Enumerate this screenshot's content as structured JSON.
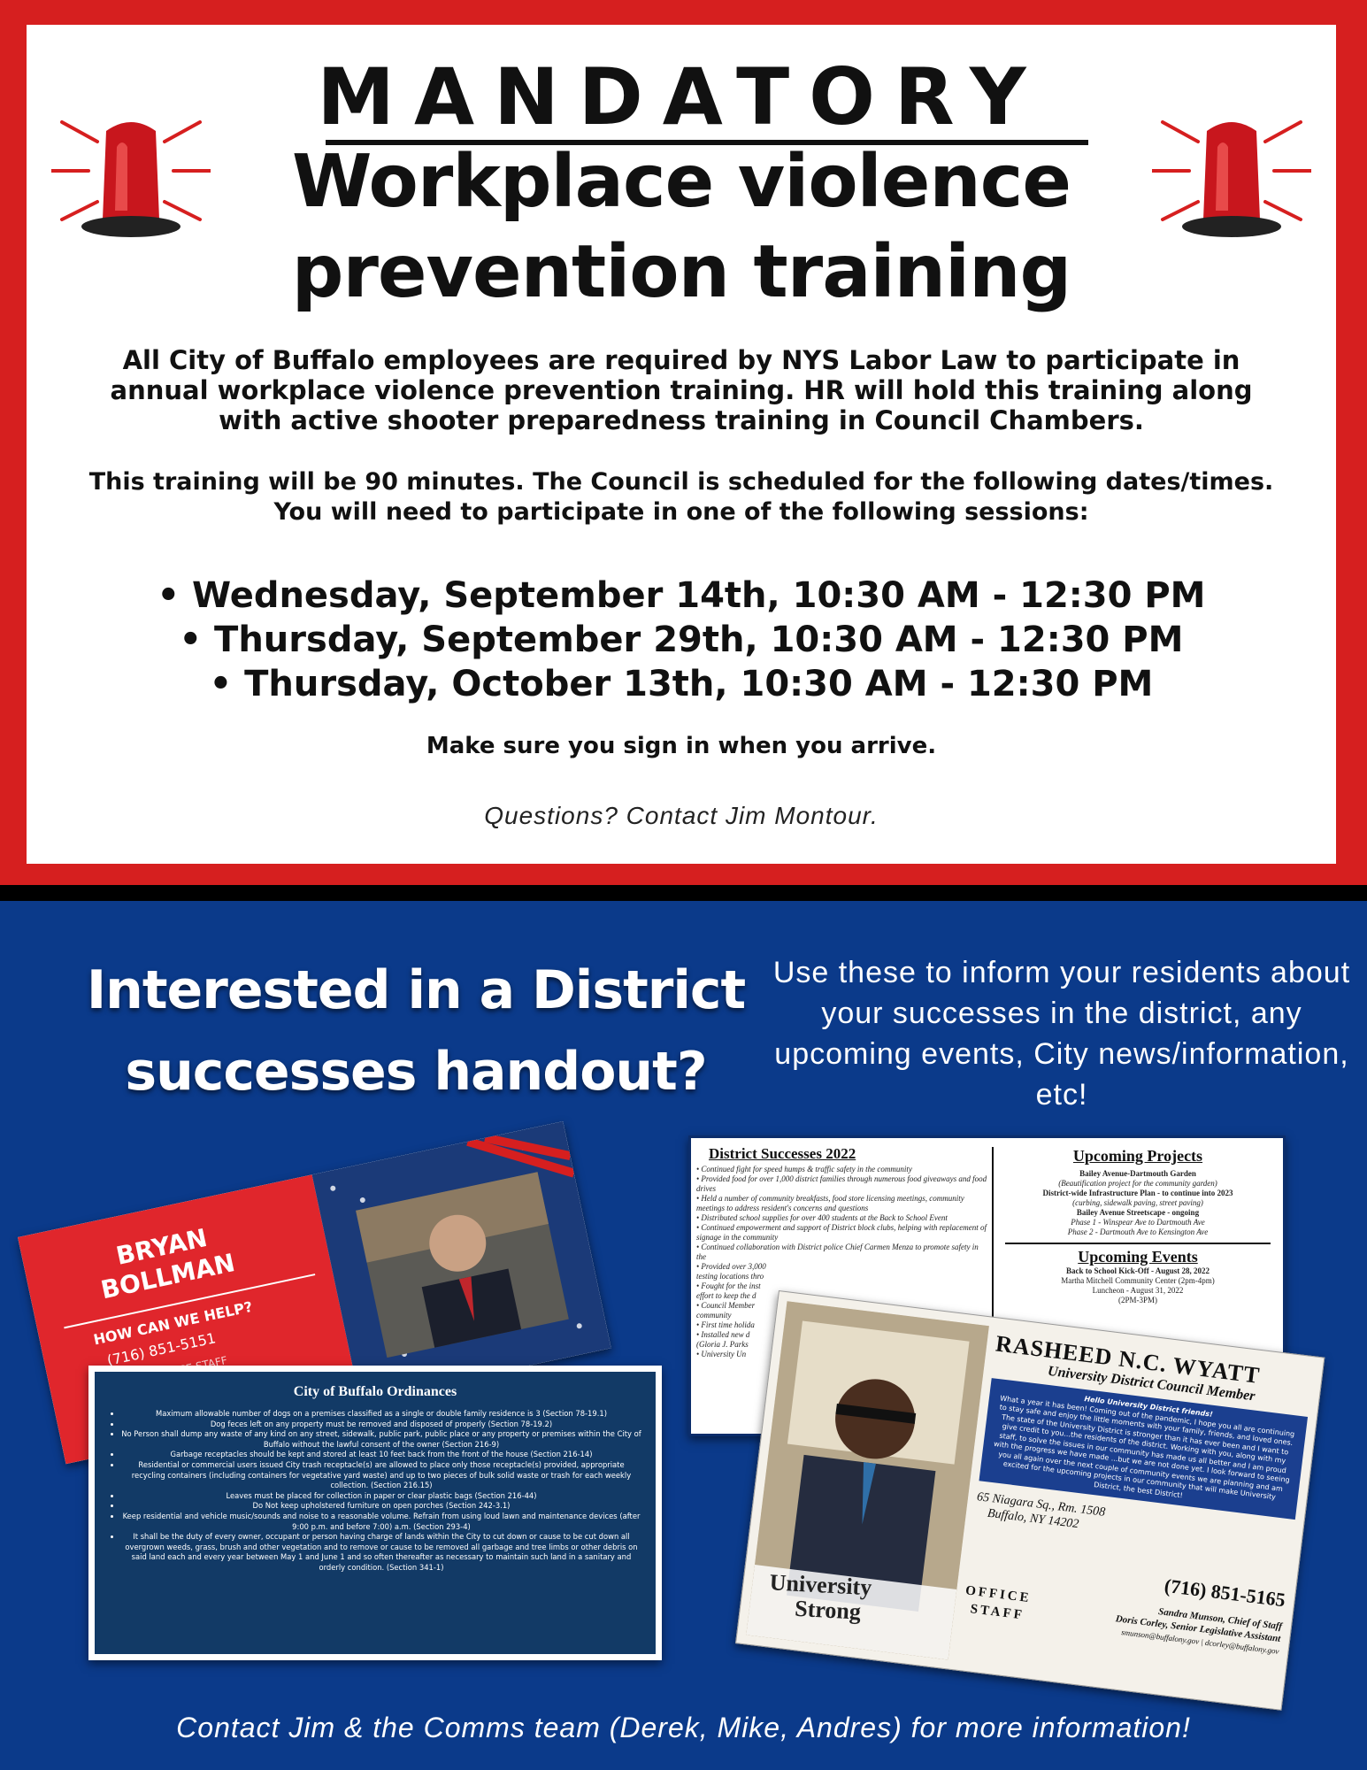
{
  "flyer": {
    "mandatory": "MANDATORY",
    "headline_line1": "Workplace violence",
    "headline_line2": "prevention training",
    "intro": "All City of Buffalo employees are required by NYS Labor Law to participate in annual workplace violence prevention training.  HR will hold this training along with active shooter preparedness training in Council Chambers.",
    "note_line1": "This training will be 90 minutes. The Council is scheduled for the following dates/times.",
    "note_line2": "You will need to participate in one of the following sessions:",
    "sessions": [
      "• Wednesday, September 14th, 10:30 AM - 12:30 PM",
      "• Thursday, September 29th, 10:30 AM - 12:30 PM",
      "• Thursday, October 13th, 10:30 AM - 12:30 PM"
    ],
    "sign_in": "Make sure you sign in when you arrive.",
    "questions": "Questions? Contact Jim Montour."
  },
  "promo": {
    "interested_line1": "Interested in a District",
    "interested_line2": "successes handout?",
    "use_these": "Use these to inform your residents about your successes in the district, any upcoming events, City news/information, etc!",
    "contact": "Contact Jim & the Comms team (Derek, Mike, Andres) for more information!"
  },
  "bollman_card": {
    "name_line1": "BRYAN",
    "name_line2": "BOLLMAN",
    "help": "HOW CAN WE HELP?",
    "phone": "(716) 851-5151",
    "staff": "OFFICE STAFF"
  },
  "ordinances_card": {
    "title": "City of Buffalo Ordinances",
    "items": [
      "Maximum allowable number of dogs on a premises classified as a single or double family residence is 3 (Section 78-19.1)",
      "Dog feces left on any property must be removed and disposed of properly (Section 78-19.2)",
      "No Person shall dump any waste of any kind on any street, sidewalk, public park, public place or any property or premises within the City of Buffalo without the lawful consent of the owner (Section 216-9)",
      "Garbage receptacles should be kept and stored at least 10 feet back from the front of the house (Section 216-14)",
      "Residential or commercial users issued City trash receptacle(s) are allowed to place only those receptacle(s) provided, appropriate recycling containers (including containers for vegetative yard waste) and up to two pieces of bulk solid waste or trash for each weekly collection. (Section 216.15)",
      "Leaves must be placed for collection in paper or clear plastic bags (Section 216-44)",
      "Do Not keep upholstered furniture on open porches (Section 242-3.1)",
      "Keep residential and vehicle music/sounds and noise to a reasonable volume. Refrain from using loud lawn and maintenance devices (after 9:00 p.m. and before 7:00) a.m. (Section 293-4)",
      "It shall be the duty of every owner, occupant or person having charge of lands within the City to cut down or cause to be cut down all overgrown weeds, grass, brush and other vegetation and to remove or cause to be removed all garbage and tree limbs or other debris on said land each and every year between May 1 and June 1 and so often thereafter as necessary to maintain such land in a sanitary and orderly condition. (Section 341-1)"
    ]
  },
  "successes_card": {
    "title": "District Successes 2022",
    "items": [
      "• Continued fight for speed humps & traffic safety in the community",
      "• Provided food for over 1,000 district families through numerous food giveaways and food drives",
      "• Held a number of community breakfasts, food store licensing meetings, community meetings to address resident's concerns and questions",
      "• Distributed school supplies for over 400 students at the Back to School Event",
      "• Continued empowerment and support of District block clubs, helping with replacement of signage in the community",
      "• Continued collaboration with District police Chief Carmen Menza to promote safety in the",
      "• Provided over 3,000",
      "testing locations thro",
      "• Fought for the inst",
      "effort to keep the d",
      "• Council Member",
      "community",
      "• First time holida",
      "• Installed new d",
      "(Gloria J. Parks",
      "• University Un"
    ],
    "projects_title": "Upcoming Projects",
    "projects": [
      "Bailey Avenue-Dartmouth Garden",
      "(Beautification project for the community garden)",
      "District-wide Infrastructure Plan - to continue into 2023",
      "(curbing, sidewalk paving, street paving)",
      "Bailey Avenue Streetscape - ongoing",
      "Phase 1 - Winspear Ave to Dartmouth Ave",
      "Phase 2 - Dartmouth Ave to Kensington Ave"
    ],
    "events_title": "Upcoming Events",
    "events": [
      "Back to School Kick-Off - August 28, 2022",
      "Martha Mitchell Community Center (2pm-4pm)",
      "Luncheon - August 31, 2022",
      "(2PM-3PM)"
    ]
  },
  "wyatt_card": {
    "name": "RASHEED N.C. WYATT",
    "role": "University District Council Member",
    "greeting": "Hello University District friends!",
    "body": "What a year it has been! Coming out of the pandemic, I hope you all are continuing to stay safe and enjoy the little moments with your family, friends, and loved ones. The state of the University District is stronger than it has ever been and I want to give credit to you...the residents of the district. Working with you, along with my staff, to solve the issues in our community has made us all better and I am proud with the progress we have made ...but we are not done yet. I look forward to seeing you all again over the next couple of community events we are planning and am excited for the upcoming projects in our community that will make University District, the best District!",
    "address_line1": "65 Niagara Sq., Rm. 1508",
    "address_line2": "Buffalo, NY 14202",
    "phone": "(716) 851-5165",
    "staff_label_1": "OFFICE",
    "staff_label_2": "STAFF",
    "staff_1": "Sandra Munson, Chief of Staff",
    "staff_2": "Doris Corley, Senior Legislative Assistant",
    "emails": "smunson@buffalony.gov | dcorley@buffalony.gov",
    "logo_1": "University",
    "logo_2": "Strong"
  },
  "colors": {
    "red": "#d61f1f",
    "navy": "#0b3a8a",
    "dark_navy": "#123a66"
  }
}
